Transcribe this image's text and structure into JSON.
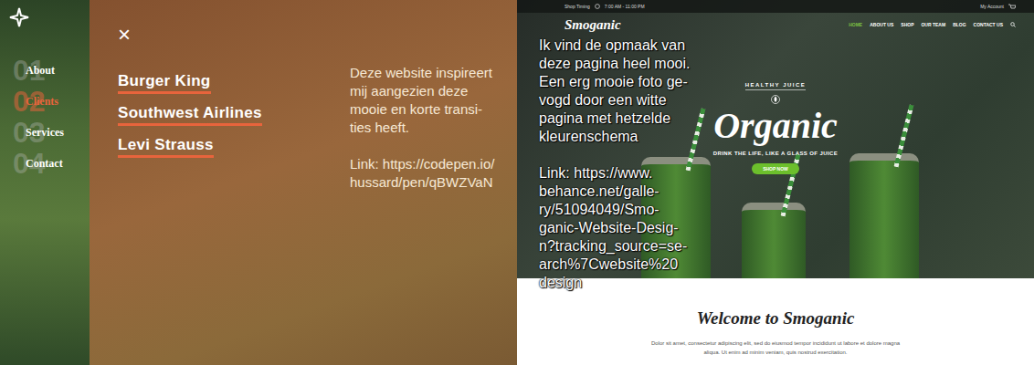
{
  "portfolio": {
    "nav": [
      {
        "number": "01",
        "label": "About",
        "selected": false
      },
      {
        "number": "02",
        "label": "Clients",
        "selected": true
      },
      {
        "number": "03",
        "label": "Services",
        "selected": false
      },
      {
        "number": "04",
        "label": "Contact",
        "selected": false
      }
    ],
    "close": "×",
    "clients": [
      "Burger King",
      "Southwest Airlines",
      "Levi Strauss"
    ],
    "note": [
      "Deze website inspireert",
      "mij aangezien deze",
      "mooie en korte transi-",
      "ties heeft."
    ],
    "link": [
      "Link: https://codepen.io/",
      "hussard/pen/qBWZVaN"
    ]
  },
  "smoganic": {
    "top_bar": {
      "label": "Shop Timing",
      "hours": "7:00 AM - 11:00 PM",
      "account": "My Account"
    },
    "logo": "Smoganic",
    "menu": [
      {
        "label": "HOME",
        "selected": true
      },
      {
        "label": "ABOUT US",
        "selected": false
      },
      {
        "label": "SHOP",
        "selected": false
      },
      {
        "label": "OUR TEAM",
        "selected": false
      },
      {
        "label": "BLOG",
        "selected": false
      },
      {
        "label": "CONTACT US",
        "selected": false
      }
    ],
    "hero": {
      "eyebrow": "HEALTHY JUICE",
      "title": "Organic",
      "tagline": "DRINK THE LIFE, LIKE A GLASS OF JUICE",
      "button": "SHOP NOW"
    },
    "welcome": {
      "title": "Welcome to Smoganic",
      "text": [
        "Dolor sit amet, consectetur adipiscing elit, sed do eiusmod tempor incididunt ut labore et dolore magna",
        "aliqua. Ut enim ad minim veniam, quis nostrud exercitation."
      ]
    },
    "note": [
      "Ik vind de opmaak van",
      "deze pagina heel mooi.",
      "Een erg mooie foto ge-",
      "vogd door een witte",
      "pagina met hetzelde",
      "kleurenschema"
    ],
    "link": [
      "Link: https://www.",
      "behance.net/galle-",
      "ry/51094049/Smo-",
      "ganic-Website-Desig-",
      "n?tracking_source=se-",
      "arch%7Cwebsite%20",
      "design"
    ]
  }
}
